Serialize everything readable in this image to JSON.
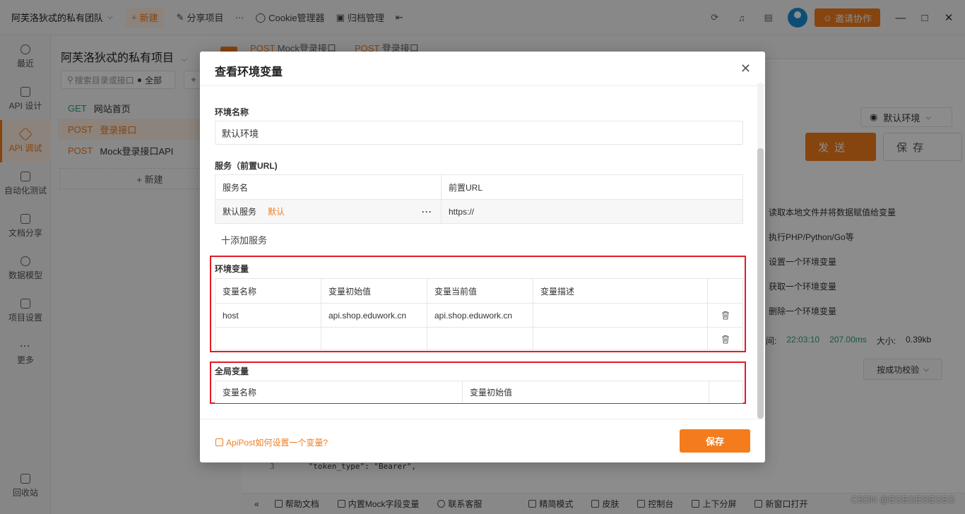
{
  "topbar": {
    "team_name": "阿芙洛狄忒的私有团队",
    "new_label": "新建",
    "share_label": "分享项目",
    "more_label": "···",
    "cookie_label": "Cookie管理器",
    "archive_label": "归档管理",
    "invite_label": "邀请协作"
  },
  "rail": {
    "items": [
      {
        "label": "最近",
        "icon": "clock-icon"
      },
      {
        "label": "API 设计",
        "icon": "edit-icon"
      },
      {
        "label": "API 调试",
        "icon": "link-icon"
      },
      {
        "label": "自动化测试",
        "icon": "flow-icon"
      },
      {
        "label": "文档分享",
        "icon": "doc-icon"
      },
      {
        "label": "数据模型",
        "icon": "model-icon"
      },
      {
        "label": "项目设置",
        "icon": "settings-icon"
      },
      {
        "label": "更多",
        "icon": "more-icon"
      }
    ],
    "recycle_label": "回收站"
  },
  "tree": {
    "project_title": "阿芙洛狄忒的私有项目",
    "search_placeholder": "搜索目录或接口",
    "filter_label": "全部",
    "items": [
      {
        "method": "GET",
        "name": "网站首页"
      },
      {
        "method": "POST",
        "name": "登录接口"
      },
      {
        "method": "POST",
        "name": "Mock登录接口API"
      }
    ],
    "new_label": "+ 新建"
  },
  "main": {
    "tabs": [
      {
        "method": "POST",
        "name": "Mock登录接口"
      },
      {
        "method": "POST",
        "name": "登录接口"
      }
    ],
    "env_select": "默认环境",
    "send_label": "发 送",
    "save_label": "保 存",
    "snippets": [
      "读取本地文件并将数据赋值给变量",
      "执行PHP/Python/Go等",
      "设置一个环境变量",
      "获取一个环境变量",
      "删除一个环境变量"
    ],
    "resp_time_label": "间:",
    "resp_time": "22:03:10",
    "resp_duration": "207.00ms",
    "resp_size_label": "大小:",
    "resp_size": "0.39kb",
    "verify_label": "按成功校验",
    "code_line_no": "3",
    "code_line": "\"token_type\": \"Bearer\","
  },
  "bottombar": {
    "items": [
      "帮助文档",
      "内置Mock字段变量",
      "联系客服",
      "精简模式",
      "皮肤",
      "控制台",
      "上下分屏",
      "新窗口打开"
    ],
    "watermark": "CSDN @EGEGEGEGEG"
  },
  "modal": {
    "title": "查看环境变量",
    "env_name_label": "环境名称",
    "env_name_value": "默认环境",
    "service_label": "服务（前置URL)",
    "service_headers": [
      "服务名",
      "前置URL"
    ],
    "service_row": {
      "name": "默认服务",
      "tag": "默认",
      "url": "https://"
    },
    "add_service_label": "十添加服务",
    "env_vars_label": "环境变量",
    "env_headers": [
      "变量名称",
      "变量初始值",
      "变量当前值",
      "变量描述"
    ],
    "env_rows": [
      {
        "name": "host",
        "init": "api.shop.eduwork.cn",
        "current": "api.shop.eduwork.cn",
        "desc": ""
      },
      {
        "name": "",
        "init": "",
        "current": "",
        "desc": ""
      }
    ],
    "global_vars_label": "全局变量",
    "global_headers": [
      "变量名称",
      "变量初始值"
    ],
    "help_link": "ApiPost如何设置一个变量?",
    "save_label": "保存"
  }
}
